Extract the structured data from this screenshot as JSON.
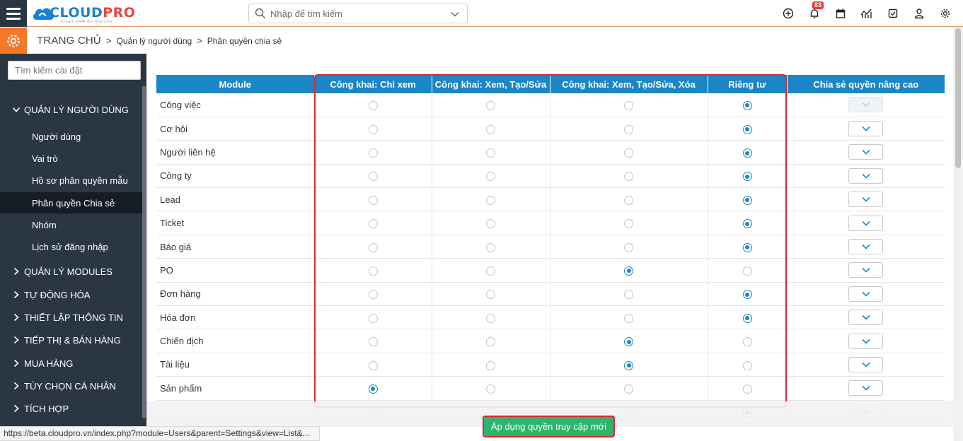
{
  "app": {
    "logo_main": "CLOUD",
    "logo_accent": "PRO",
    "logo_tagline": "Cloud CRM By Industry"
  },
  "search": {
    "placeholder": "Nhập để tìm kiếm"
  },
  "notifications": {
    "count": "83"
  },
  "top_icons": [
    "plus-circle-icon",
    "bell-icon",
    "calendar-icon",
    "chart-icon",
    "checkbox-icon",
    "user-icon",
    "gear-icon"
  ],
  "breadcrumb": {
    "home": "TRANG CHỦ",
    "items": [
      "Quản lý người dùng",
      "Phân quyền chia sẻ"
    ]
  },
  "sidebar": {
    "search_placeholder": "Tìm kiếm cài đặt",
    "open_group": "QUẢN LÝ NGƯỜI DÙNG",
    "items": [
      "Người dùng",
      "Vai trò",
      "Hồ sơ phân quyền mẫu",
      "Phân quyền Chia sẻ",
      "Nhóm",
      "Lịch sử đăng nhập"
    ],
    "active_item": "Phân quyền Chia sẻ",
    "groups": [
      "QUẢN LÝ MODULES",
      "TỰ ĐỘNG HÓA",
      "THIẾT LẬP THÔNG TIN",
      "TIẾP THỊ & BÁN HÀNG",
      "MUA HÀNG",
      "TÙY CHỌN CÁ NHÂN",
      "TÍCH HỢP"
    ]
  },
  "table": {
    "headers": [
      "Module",
      "Công khai: Chỉ xem",
      "Công khai: Xem, Tạo/Sửa",
      "Công khai: Xem, Tạo/Sửa, Xóa",
      "Riêng tư",
      "Chia sẻ quyền nâng cao"
    ],
    "rows": [
      {
        "module": "Công việc",
        "selected": 3,
        "advanced_enabled": false
      },
      {
        "module": "Cơ hội",
        "selected": 3,
        "advanced_enabled": true
      },
      {
        "module": "Người liên hệ",
        "selected": 3,
        "advanced_enabled": true
      },
      {
        "module": "Công ty",
        "selected": 3,
        "advanced_enabled": true
      },
      {
        "module": "Lead",
        "selected": 3,
        "advanced_enabled": true
      },
      {
        "module": "Ticket",
        "selected": 3,
        "advanced_enabled": true
      },
      {
        "module": "Báo giá",
        "selected": 3,
        "advanced_enabled": true
      },
      {
        "module": "PO",
        "selected": 2,
        "advanced_enabled": true
      },
      {
        "module": "Đơn hàng",
        "selected": 3,
        "advanced_enabled": true
      },
      {
        "module": "Hóa đơn",
        "selected": 3,
        "advanced_enabled": true
      },
      {
        "module": "Chiến dịch",
        "selected": 2,
        "advanced_enabled": true
      },
      {
        "module": "Tài liệu",
        "selected": 2,
        "advanced_enabled": true
      },
      {
        "module": "Sản phẩm",
        "selected": 0,
        "advanced_enabled": true
      },
      {
        "module": "",
        "selected": 3,
        "advanced_enabled": true
      }
    ]
  },
  "apply_button": "Áp dụng quyền truy cập mới",
  "status_bar": {
    "url": "https://beta.cloudpro.vn/index.php?module=Users&parent=Settings&view=List&..."
  },
  "colors": {
    "header_blue": "#1b86c6",
    "sidebar_bg": "#2b3643",
    "accent_orange": "#f5782a",
    "apply_green": "#2db56d",
    "highlight_red": "#e0262f"
  }
}
